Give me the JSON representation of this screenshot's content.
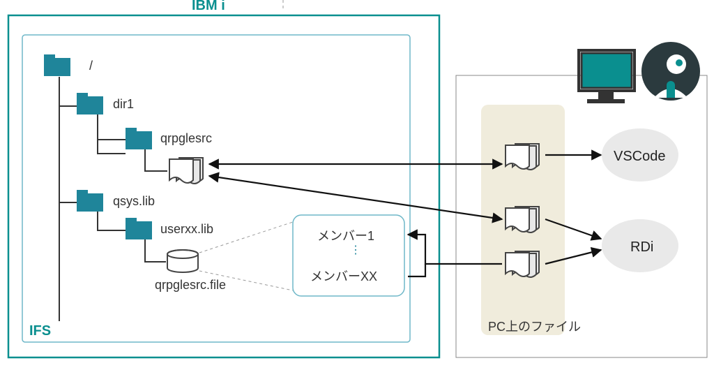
{
  "title_ibmi": "IBM i",
  "ifs": "IFS",
  "folders": {
    "root": "/",
    "dir1": "dir1",
    "qrpglesrc": "qrpglesrc",
    "qsyslib": "qsys.lib",
    "userxxlib": "userxx.lib"
  },
  "dbfile": "qrpglesrc.file",
  "members": {
    "m1": "メンバー1",
    "mxx": "メンバーXX"
  },
  "pc": "PC上のファイル",
  "apps": {
    "vscode": "VSCode",
    "rdi": "RDi"
  },
  "colors": {
    "teal": "#0a8f8f",
    "folder": "#1f859a",
    "beige": "#f0ecdc"
  }
}
